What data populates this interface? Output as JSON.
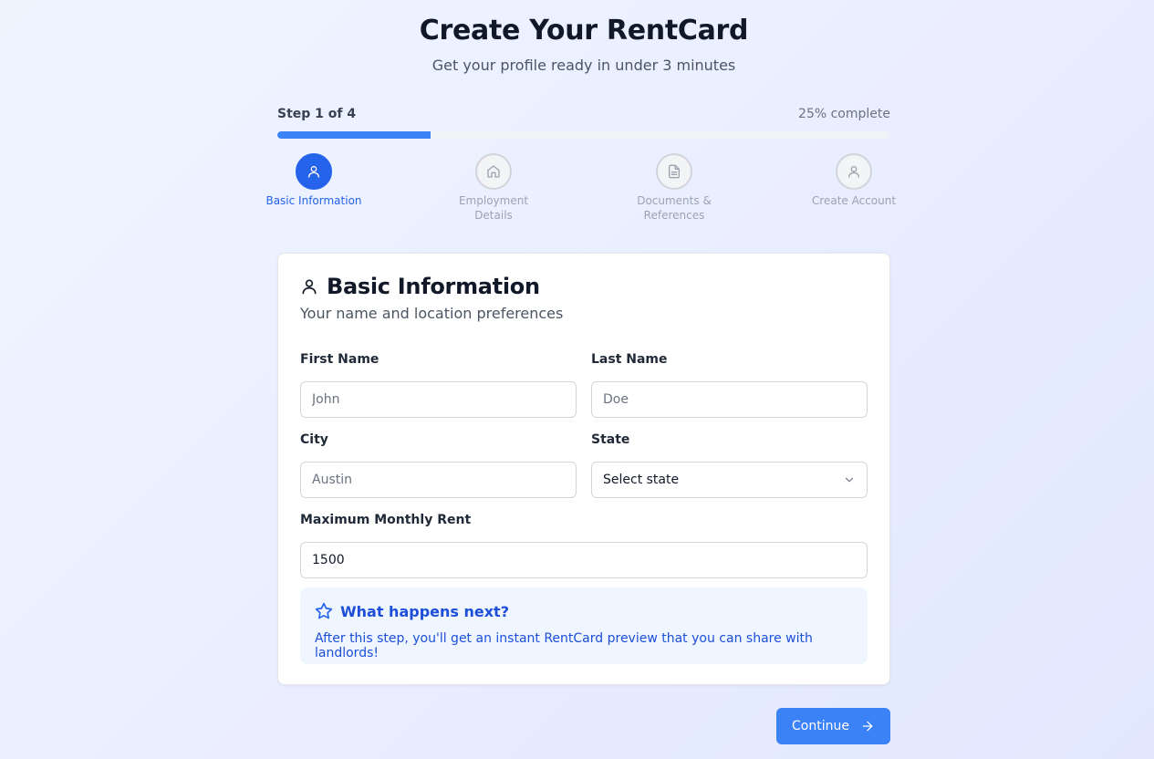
{
  "header": {
    "title": "Create Your RentCard",
    "subtitle": "Get your profile ready in under 3 minutes"
  },
  "progress": {
    "step_label": "Step 1 of 4",
    "percent_label": "25% complete",
    "percent": 25,
    "color": "#3b82f6"
  },
  "steps": [
    {
      "label": "Basic Information",
      "icon": "user-icon",
      "active": true
    },
    {
      "label": "Employment Details",
      "icon": "home-icon",
      "active": false
    },
    {
      "label": "Documents & References",
      "icon": "document-icon",
      "active": false
    },
    {
      "label": "Create Account",
      "icon": "user-icon",
      "active": false
    }
  ],
  "form": {
    "title": "Basic Information",
    "subtitle": "Your name and location preferences",
    "first_name": {
      "label": "First Name",
      "placeholder": "John",
      "value": ""
    },
    "last_name": {
      "label": "Last Name",
      "placeholder": "Doe",
      "value": ""
    },
    "city": {
      "label": "City",
      "placeholder": "Austin",
      "value": ""
    },
    "state": {
      "label": "State",
      "value": "Select state"
    },
    "max_rent": {
      "label": "Maximum Monthly Rent",
      "value": "1500"
    }
  },
  "info": {
    "title": "What happens next?",
    "text": "After this step, you'll get an instant RentCard preview that you can share with landlords!",
    "icon": "star-icon"
  },
  "actions": {
    "continue_label": "Continue"
  },
  "colors": {
    "accent": "#2563eb",
    "button": "#3b82f6",
    "info_bg": "#eff6ff"
  }
}
